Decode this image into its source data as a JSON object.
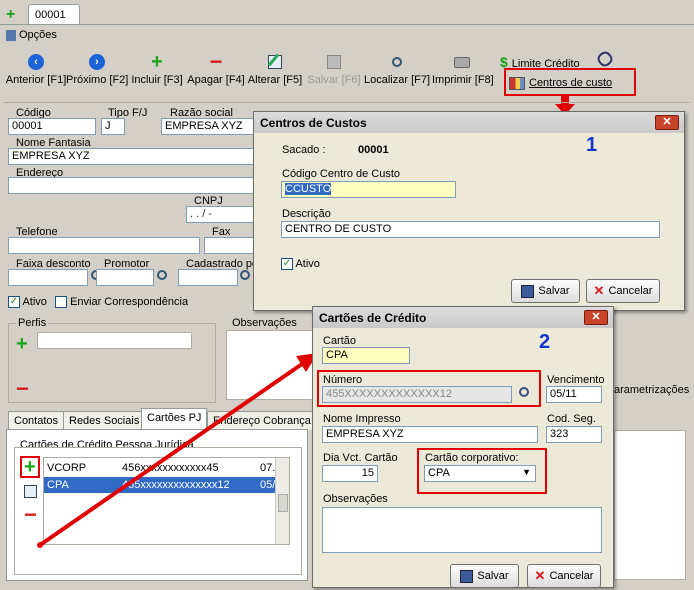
{
  "top_tab": "00001",
  "opcoes": "Opções",
  "toolbar": {
    "anterior": "Anterior [F1]",
    "proximo": "Próximo [F2]",
    "incluir": "Incluir [F3]",
    "apagar": "Apagar [F4]",
    "alterar": "Alterar [F5]",
    "salvar": "Salvar [F6]",
    "localizar": "Localizar [F7]",
    "imprimir": "Imprimir [F8]",
    "limite_credito": "Limite Crédito",
    "centros_custo": "Centros de custo"
  },
  "form": {
    "codigo_label": "Código",
    "codigo_value": "00001",
    "tipo_label": "Tipo F/J",
    "tipo_value": "J",
    "razao_label": "Razão social",
    "razao_value": "EMPRESA XYZ",
    "nome_fantasia_label": "Nome Fantasia",
    "nome_fantasia_value": "EMPRESA XYZ",
    "endereco_label": "Endereço",
    "cnpj_label": "CNPJ",
    "cnpj_value": ". . / -",
    "telefone_label": "Telefone",
    "fax_label": "Fax",
    "faixa_label": "Faixa desconto",
    "promotor_label": "Promotor",
    "cadastrado_label": "Cadastrado po",
    "ativo_label": "Ativo",
    "enviar_label": "Enviar Correspondência",
    "perfis_label": "Perfis",
    "observacoes_label": "Observações",
    "parametrizacoes_label": "arametrizações"
  },
  "tabs": [
    "Contatos",
    "Redes Sociais",
    "Cartões PJ",
    "Endereço Cobrança"
  ],
  "cartoes_pj": {
    "group_label": "Cartões de Crédito Pessoa Jurídica",
    "rows": [
      {
        "nome": "VCORP",
        "numero": "456xxxxxxxxxxxx45",
        "venc": "07."
      },
      {
        "nome": "CPA",
        "numero": "455xxxxxxxxxxxxxx12",
        "venc": "05/"
      }
    ]
  },
  "dialog_centros": {
    "title": "Centros de Custos",
    "sacado_label": "Sacado :",
    "sacado_value": "00001",
    "codigo_label": "Código Centro de Custo",
    "codigo_value": "CCUSTO",
    "descricao_label": "Descrição",
    "descricao_value": "CENTRO DE CUSTO",
    "ativo_label": "Ativo",
    "salvar": "Salvar",
    "cancelar": "Cancelar",
    "annotation": "1"
  },
  "dialog_cartoes": {
    "title": "Cartões de Crédito",
    "cartao_label": "Cartão",
    "cartao_value": "CPA",
    "numero_label": "Número",
    "numero_value": "455XXXXXXXXXXXXX12",
    "vencimento_label": "Vencimento",
    "vencimento_value": "05/11",
    "nome_impresso_label": "Nome Impresso",
    "nome_impresso_value": "EMPRESA XYZ",
    "cod_seg_label": "Cod. Seg.",
    "cod_seg_value": "323",
    "dia_vct_label": "Dia Vct. Cartão",
    "dia_vct_value": "15",
    "corporativo_label": "Cartão corporativo:",
    "corporativo_value": "CPA",
    "observacoes_label": "Observações",
    "salvar": "Salvar",
    "cancelar": "Cancelar",
    "annotation": "2"
  },
  "colors": {
    "annotation_red": "#e00000",
    "annotation_blue": "#1234c8",
    "selected_row": "#316ac5"
  }
}
